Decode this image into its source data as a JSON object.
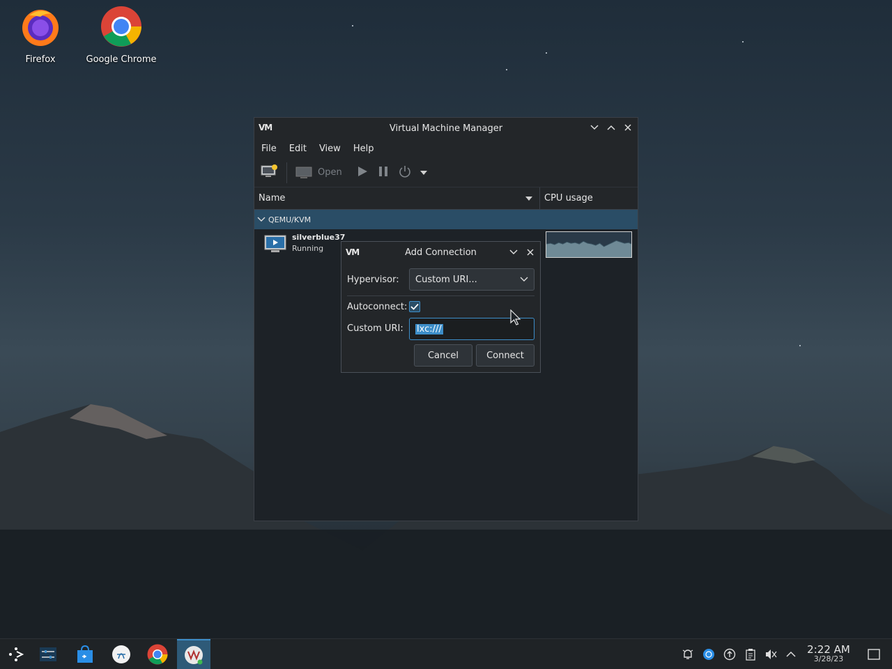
{
  "desktop": {
    "icons": [
      {
        "label": "Firefox",
        "icon": "firefox-icon"
      },
      {
        "label": "Google Chrome",
        "icon": "chrome-icon"
      }
    ]
  },
  "vmm": {
    "title": "Virtual Machine Manager",
    "menu": [
      "File",
      "Edit",
      "View",
      "Help"
    ],
    "toolbar": {
      "open_label": "Open",
      "icons": [
        "new-vm-icon",
        "open-console-icon",
        "play-icon",
        "pause-icon",
        "power-icon",
        "dropdown-arrow-icon"
      ]
    },
    "columns": {
      "name": "Name",
      "cpu": "CPU usage"
    },
    "group": "QEMU/KVM",
    "vms": [
      {
        "name": "silverblue37",
        "status": "Running"
      }
    ]
  },
  "dialog": {
    "title": "Add Connection",
    "hypervisor_label": "Hypervisor:",
    "hypervisor_value": "Custom URI...",
    "autoconnect_label": "Autoconnect:",
    "autoconnect_checked": true,
    "uri_label": "Custom URI:",
    "uri_value": "lxc:///",
    "cancel": "Cancel",
    "connect": "Connect"
  },
  "taskbar": {
    "apps": [
      "launcher-icon",
      "settings-sliders-icon",
      "software-store-icon",
      "podman-icon",
      "chrome-icon",
      "virt-manager-icon"
    ],
    "tray": [
      "notifications-icon",
      "network-icon",
      "updates-icon",
      "clipboard-icon",
      "volume-muted-icon",
      "expand-tray-icon"
    ],
    "time": "2:22 AM",
    "date": "3/28/23"
  },
  "colors": {
    "accent": "#3d8ec9",
    "selection_row": "#2a4d66",
    "window_bg": "#1d2227"
  }
}
